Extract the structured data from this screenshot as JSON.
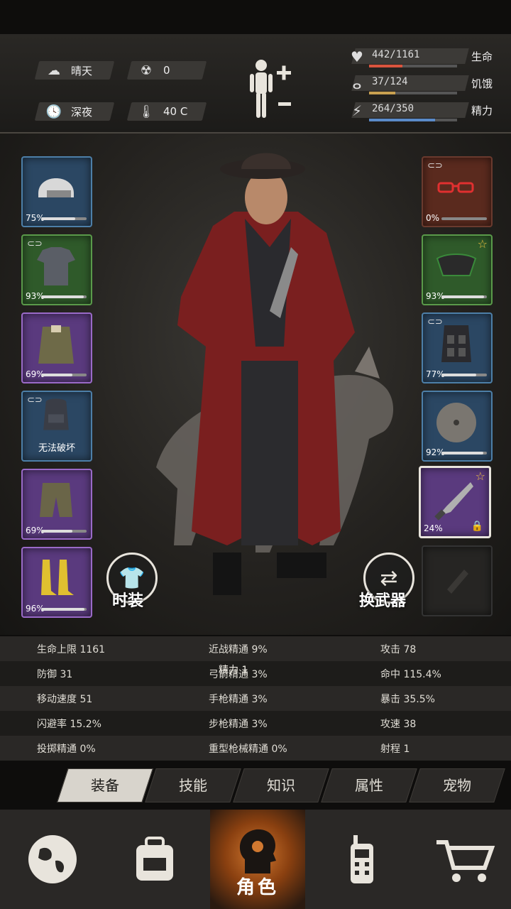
{
  "environment": {
    "weather": {
      "icon": "cloud-sun-icon",
      "label": "晴天"
    },
    "radiation": {
      "icon": "radiation-icon",
      "value": "0"
    },
    "time": {
      "icon": "clock-icon",
      "label": "深夜"
    },
    "temperature": {
      "icon": "thermometer-icon",
      "value": "40 C"
    }
  },
  "vitals": [
    {
      "name": "health",
      "icon": "heart-icon",
      "value": "442/1161",
      "label": "生命",
      "ratio": 0.38,
      "color": "#d9543e"
    },
    {
      "name": "hunger",
      "icon": "stomach-icon",
      "value": "37/124",
      "label": "饥饿",
      "ratio": 0.3,
      "color": "#c8a050"
    },
    {
      "name": "energy",
      "icon": "energy-icon",
      "value": "264/350",
      "label": "精力",
      "ratio": 0.75,
      "color": "#5a8ac8"
    }
  ],
  "left_slots": [
    {
      "name": "helmet",
      "pct": "75%",
      "durability": 0.75
    },
    {
      "name": "shirt",
      "pct": "93%",
      "durability": 0.93
    },
    {
      "name": "jacket",
      "pct": "69%",
      "durability": 0.69
    },
    {
      "name": "backpack",
      "text": "无法破坏"
    },
    {
      "name": "pants",
      "pct": "69%",
      "durability": 0.69
    },
    {
      "name": "boots",
      "pct": "96%",
      "durability": 0.96
    }
  ],
  "right_slots": [
    {
      "name": "glasses",
      "pct": "0%",
      "durability": 0.0
    },
    {
      "name": "mask",
      "pct": "93%",
      "durability": 0.93
    },
    {
      "name": "vest",
      "pct": "77%",
      "durability": 0.77
    },
    {
      "name": "shield",
      "pct": "92%",
      "durability": 0.92
    },
    {
      "name": "machete",
      "pct": "24%",
      "durability": 0.24
    },
    {
      "name": "empty-weapon-slot"
    }
  ],
  "actions": {
    "fashion": "时装",
    "swap_weapon": "换武器"
  },
  "stats": [
    [
      "生命上限 1161",
      "近战精通 9%",
      "攻击 78"
    ],
    [
      "防御 31",
      "弓箭精通 3%",
      "命中 115.4%"
    ],
    [
      "移动速度 51",
      "手枪精通 3%",
      "暴击 35.5%"
    ],
    [
      "闪避率 15.2%",
      "步枪精通 3%",
      "攻速 38"
    ],
    [
      "投掷精通 0%",
      "重型枪械精通 0%",
      "射程 1"
    ]
  ],
  "overlay_text": "精力 1",
  "tabs": [
    "装备",
    "技能",
    "知识",
    "属性",
    "宠物"
  ],
  "nav": {
    "character_label": "角色"
  }
}
